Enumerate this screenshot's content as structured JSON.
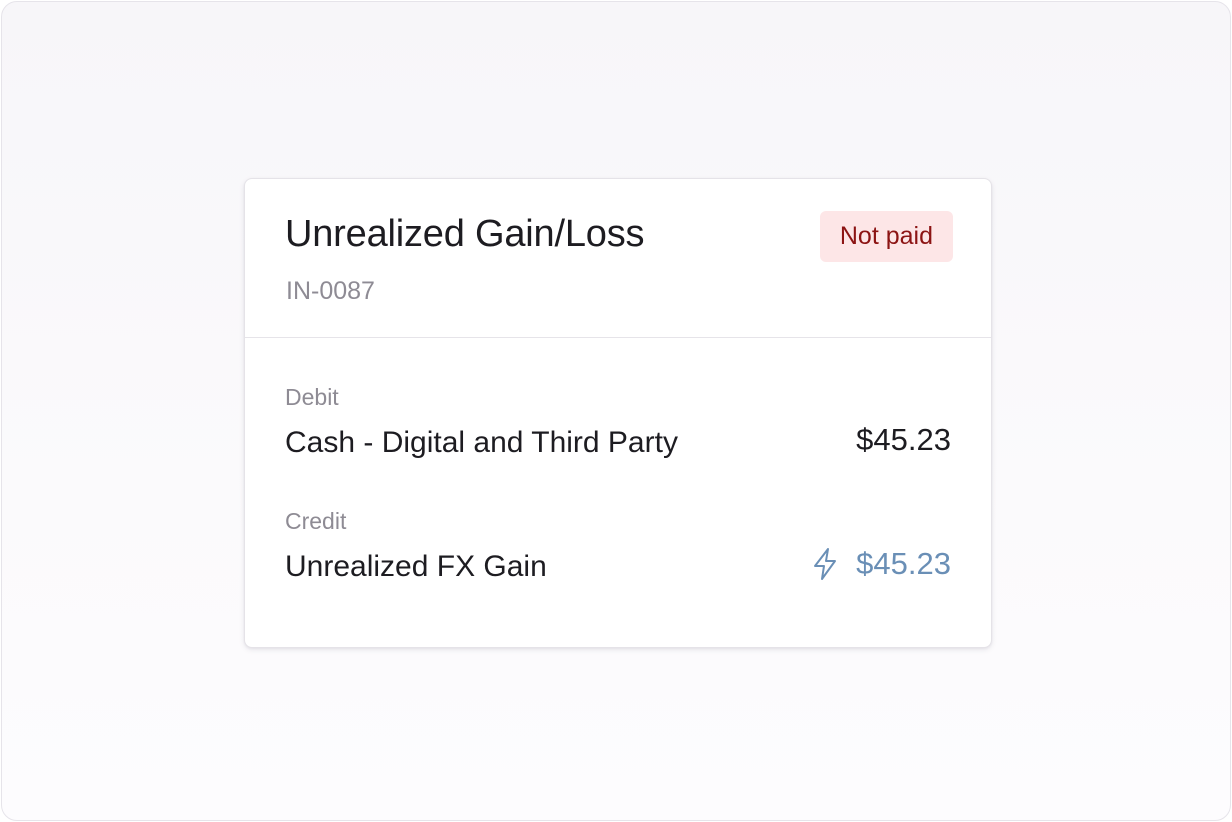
{
  "card": {
    "title": "Unrealized Gain/Loss",
    "reference": "IN-0087",
    "status": "Not paid"
  },
  "entries": [
    {
      "label": "Debit",
      "account": "Cash - Digital and Third Party",
      "amount": "$45.23",
      "icon": null
    },
    {
      "label": "Credit",
      "account": "Unrealized FX Gain",
      "amount": "$45.23",
      "icon": "lightning-bolt-icon"
    }
  ],
  "colors": {
    "status_bg": "#fde6e7",
    "status_text": "#8c1414",
    "accent_amount": "#6a8fb6",
    "text_primary": "#1d1c21",
    "text_secondary": "#8e8b94"
  }
}
